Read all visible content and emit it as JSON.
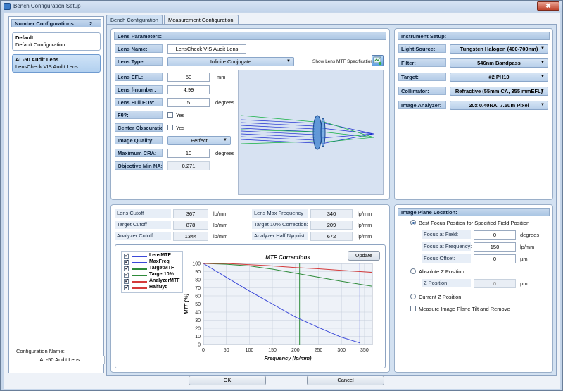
{
  "window": {
    "title": "Bench Configuration Setup",
    "close_glyph": "✖"
  },
  "sidebar": {
    "header_label": "Number Configurations:",
    "count": "2",
    "items": [
      {
        "name": "Default",
        "sub": "Default Configuration"
      },
      {
        "name": "AL-50 Audit Lens",
        "sub": "LensCheck VIS Audit Lens"
      }
    ],
    "config_name_label": "Configuration Name:",
    "config_name_value": "AL-50 Audit Lens"
  },
  "tabs": [
    "Bench Configuration",
    "Measurement Configuration"
  ],
  "lens": {
    "header": "Lens Parameters:",
    "name_label": "Lens Name:",
    "name_value": "LensCheck VIS Audit Lens",
    "type_label": "Lens Type:",
    "type_value": "Infinite Conjugate",
    "show_mtf_label": "Show Lens MTF Specification:",
    "efl_label": "Lens EFL:",
    "efl_value": "50",
    "efl_unit": "mm",
    "fnum_label": "Lens f-number:",
    "fnum_value": "4.99",
    "fov_label": "Lens Full FOV:",
    "fov_value": "5",
    "fov_unit": "degrees",
    "ftheta_label": "Fθ?:",
    "ftheta_yes": "Yes",
    "obsc_label": "Center Obscuration?:",
    "obsc_yes": "Yes",
    "iq_label": "Image Quality:",
    "iq_value": "Perfect",
    "cra_label": "Maximum CRA:",
    "cra_value": "10",
    "cra_unit": "degrees",
    "na_label": "Objective Min NA:",
    "na_value": "0.271"
  },
  "instrument": {
    "header": "Instrument Setup:",
    "rows": [
      {
        "label": "Light Source:",
        "value": "Tungsten Halogen (400-700nm)"
      },
      {
        "label": "Filter:",
        "value": "546nm Bandpass"
      },
      {
        "label": "Target:",
        "value": "#2 PH10"
      },
      {
        "label": "Collimator:",
        "value": "Refractive (55mm CA, 355 mmEFL)"
      },
      {
        "label": "Image Analyzer:",
        "value": "20x 0.40NA, 7.5um Pixel"
      }
    ]
  },
  "freqs": {
    "unit": "lp/mm",
    "left": [
      {
        "label": "Lens Cutoff",
        "value": "367"
      },
      {
        "label": "Target Cutoff",
        "value": "878"
      },
      {
        "label": "Analyzer Cutoff",
        "value": "1344"
      }
    ],
    "right": [
      {
        "label": "Lens Max Frequency",
        "value": "340"
      },
      {
        "label": "Target 10% Correction:",
        "value": "209"
      },
      {
        "label": "Analyzer Half Nyquist",
        "value": "672"
      }
    ]
  },
  "mtf": {
    "update_label": "Update",
    "legend": [
      {
        "name": "LensMTF",
        "color": "#3a48d8"
      },
      {
        "name": "MaxFreq",
        "color": "#3a48d8"
      },
      {
        "name": "TargetMTF",
        "color": "#2e8b3a"
      },
      {
        "name": "Target10%",
        "color": "#2e8b3a"
      },
      {
        "name": "AnalyzerMTF",
        "color": "#d43a3a"
      },
      {
        "name": "HalfNyq",
        "color": "#d43a3a"
      }
    ]
  },
  "chart_data": {
    "type": "line",
    "title": "MTF Corrections",
    "xlabel": "Frequency (lp/mm)",
    "ylabel": "MTF (%)",
    "xlim": [
      0,
      367
    ],
    "ylim": [
      0,
      100
    ],
    "xticks": [
      0,
      50,
      100,
      150,
      200,
      250,
      300,
      350
    ],
    "yticks": [
      0,
      10,
      20,
      30,
      40,
      50,
      60,
      70,
      80,
      90,
      100
    ],
    "grid": true,
    "series": [
      {
        "name": "LensMTF",
        "color": "#3a48d8",
        "x": [
          0,
          50,
          100,
          150,
          200,
          250,
          300,
          340
        ],
        "y": [
          100,
          83,
          66,
          50,
          34,
          21,
          9,
          2
        ]
      },
      {
        "name": "TargetMTF",
        "color": "#2e8b3a",
        "x": [
          0,
          50,
          100,
          150,
          200,
          250,
          300,
          367
        ],
        "y": [
          100,
          99,
          97,
          93,
          88,
          83,
          78,
          72
        ]
      },
      {
        "name": "AnalyzerMTF",
        "color": "#d43a3a",
        "x": [
          0,
          50,
          100,
          150,
          200,
          250,
          300,
          367
        ],
        "y": [
          100,
          100,
          98.5,
          97,
          95,
          93.5,
          91.5,
          89
        ]
      }
    ],
    "vlines": [
      {
        "name": "MaxFreq",
        "x": 340,
        "color": "#3a48d8"
      },
      {
        "name": "Target10%",
        "x": 209,
        "color": "#2e8b3a"
      }
    ]
  },
  "image_plane": {
    "header": "Image Plane Location:",
    "opt_best": "Best Focus Position for Specified Field Position",
    "focus_field_label": "Focus at Field:",
    "focus_field_value": "0",
    "focus_field_unit": "degrees",
    "focus_freq_label": "Focus at Frequency:",
    "focus_freq_value": "150",
    "focus_freq_unit": "lp/mm",
    "focus_offset_label": "Focus Offset:",
    "focus_offset_value": "0",
    "focus_offset_unit": "µm",
    "opt_abs": "Absolute Z Position",
    "zpos_label": "Z Position:",
    "zpos_value": "0",
    "zpos_unit": "µm",
    "opt_current": "Current Z Position",
    "measure_tilt": "Measure Image Plane Tilt and Remove"
  },
  "buttons": {
    "ok": "OK",
    "cancel": "Cancel"
  }
}
